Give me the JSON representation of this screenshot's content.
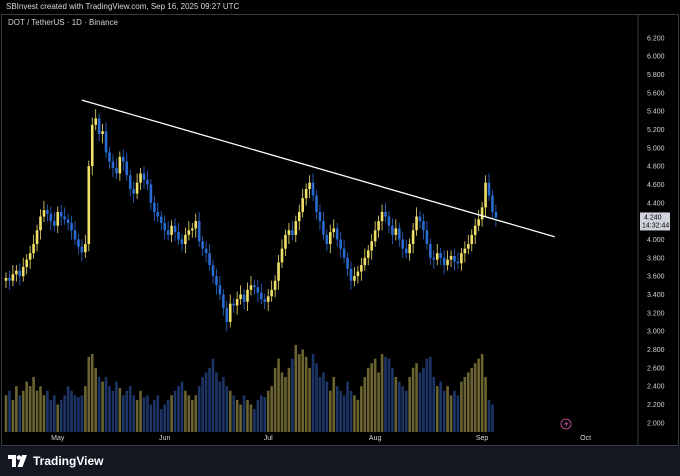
{
  "credit": "SBInvest created with TradingView.com, Sep 16, 2025 09:27 UTC",
  "symbol": "DOT / TetherUS · 1D · Binance",
  "brand": "TradingView",
  "colors": {
    "up": "#f0e06a",
    "down": "#2a6bd1",
    "vol_up": "#6b6330",
    "vol_down": "#1c3566",
    "trendline": "#ffffff",
    "background": "#000000"
  },
  "chart_data": {
    "type": "candlestick",
    "title": "DOT / TetherUS · 1D · Binance",
    "ylim": [
      1.9,
      6.35
    ],
    "y_ticks": [
      "6.200",
      "6.000",
      "5.800",
      "5.600",
      "5.400",
      "5.200",
      "5.000",
      "4.800",
      "4.600",
      "4.400",
      "4.200",
      "4.000",
      "3.800",
      "3.600",
      "3.400",
      "3.200",
      "3.000",
      "2.800",
      "2.600",
      "2.400",
      "2.200",
      "2.000"
    ],
    "y_tick_values": [
      6.2,
      6.0,
      5.8,
      5.6,
      5.4,
      5.2,
      5.0,
      4.8,
      4.6,
      4.4,
      4.2,
      4.0,
      3.8,
      3.6,
      3.4,
      3.2,
      3.0,
      2.8,
      2.6,
      2.4,
      2.2,
      2.0
    ],
    "x_ticks": [
      {
        "label": "May",
        "day": 15
      },
      {
        "label": "Jun",
        "day": 46
      },
      {
        "label": "Jul",
        "day": 76
      },
      {
        "label": "Aug",
        "day": 107
      },
      {
        "label": "Sep",
        "day": 138
      },
      {
        "label": "Oct",
        "day": 168
      }
    ],
    "last_price": "4.240",
    "countdown": "14:32:44",
    "close_series": [
      3.58,
      3.55,
      3.62,
      3.66,
      3.6,
      3.7,
      3.78,
      3.85,
      3.95,
      4.1,
      4.25,
      4.32,
      4.28,
      4.2,
      4.15,
      4.3,
      4.25,
      4.22,
      4.18,
      4.1,
      4.0,
      3.92,
      3.86,
      3.95,
      4.8,
      5.25,
      5.32,
      5.15,
      5.18,
      4.95,
      4.85,
      4.78,
      4.72,
      4.9,
      4.85,
      4.7,
      4.55,
      4.5,
      4.62,
      4.72,
      4.65,
      4.6,
      4.4,
      4.3,
      4.25,
      4.18,
      4.1,
      4.05,
      4.15,
      4.08,
      4.0,
      3.95,
      4.05,
      4.1,
      4.12,
      4.2,
      3.98,
      3.9,
      3.85,
      3.72,
      3.6,
      3.5,
      3.4,
      3.25,
      3.1,
      3.3,
      3.28,
      3.35,
      3.4,
      3.32,
      3.45,
      3.5,
      3.48,
      3.42,
      3.35,
      3.32,
      3.38,
      3.45,
      3.55,
      3.75,
      3.9,
      4.05,
      4.1,
      4.05,
      4.2,
      4.3,
      4.45,
      4.55,
      4.62,
      4.48,
      4.3,
      4.2,
      4.05,
      3.95,
      4.08,
      4.12,
      4.0,
      3.9,
      3.8,
      3.68,
      3.55,
      3.6,
      3.65,
      3.72,
      3.8,
      3.88,
      3.98,
      4.1,
      4.2,
      4.3,
      4.25,
      4.15,
      4.05,
      4.12,
      4.0,
      3.9,
      3.85,
      3.95,
      4.1,
      4.25,
      4.2,
      4.1,
      3.95,
      3.8,
      3.78,
      3.85,
      3.8,
      3.72,
      3.78,
      3.82,
      3.76,
      3.74,
      3.85,
      3.9,
      3.95,
      4.05,
      4.15,
      4.22,
      4.35,
      4.62,
      4.48,
      4.3,
      4.24
    ],
    "volume_series": [
      2.3,
      2.35,
      2.25,
      2.4,
      2.3,
      2.35,
      2.45,
      2.4,
      2.5,
      2.35,
      2.4,
      2.3,
      2.35,
      2.25,
      2.3,
      2.2,
      2.25,
      2.3,
      2.4,
      2.35,
      2.3,
      2.28,
      2.3,
      2.4,
      2.72,
      2.75,
      2.6,
      2.5,
      2.45,
      2.5,
      2.4,
      2.35,
      2.45,
      2.38,
      2.3,
      2.35,
      2.4,
      2.3,
      2.25,
      2.35,
      2.28,
      2.3,
      2.2,
      2.25,
      2.3,
      2.15,
      2.2,
      2.25,
      2.3,
      2.35,
      2.4,
      2.45,
      2.35,
      2.3,
      2.25,
      2.3,
      2.4,
      2.5,
      2.55,
      2.6,
      2.7,
      2.55,
      2.45,
      2.5,
      2.4,
      2.35,
      2.3,
      2.25,
      2.2,
      2.3,
      2.25,
      2.2,
      2.15,
      2.25,
      2.3,
      2.28,
      2.35,
      2.4,
      2.6,
      2.7,
      2.55,
      2.5,
      2.6,
      2.7,
      2.85,
      2.75,
      2.8,
      2.72,
      2.6,
      2.75,
      2.65,
      2.5,
      2.55,
      2.45,
      2.35,
      2.5,
      2.4,
      2.35,
      2.3,
      2.45,
      2.35,
      2.3,
      2.25,
      2.4,
      2.5,
      2.6,
      2.65,
      2.7,
      2.55,
      2.75,
      2.72,
      2.7,
      2.6,
      2.5,
      2.45,
      2.4,
      2.35,
      2.5,
      2.6,
      2.65,
      2.55,
      2.6,
      2.7,
      2.72,
      2.5,
      2.4,
      2.45,
      2.35,
      2.4,
      2.3,
      2.35,
      2.3,
      2.45,
      2.5,
      2.55,
      2.6,
      2.65,
      2.7,
      2.75,
      2.5,
      2.25,
      2.2
    ],
    "trendline": [
      {
        "day": 22,
        "price": 5.52
      },
      {
        "day": 159,
        "price": 4.03
      }
    ]
  }
}
